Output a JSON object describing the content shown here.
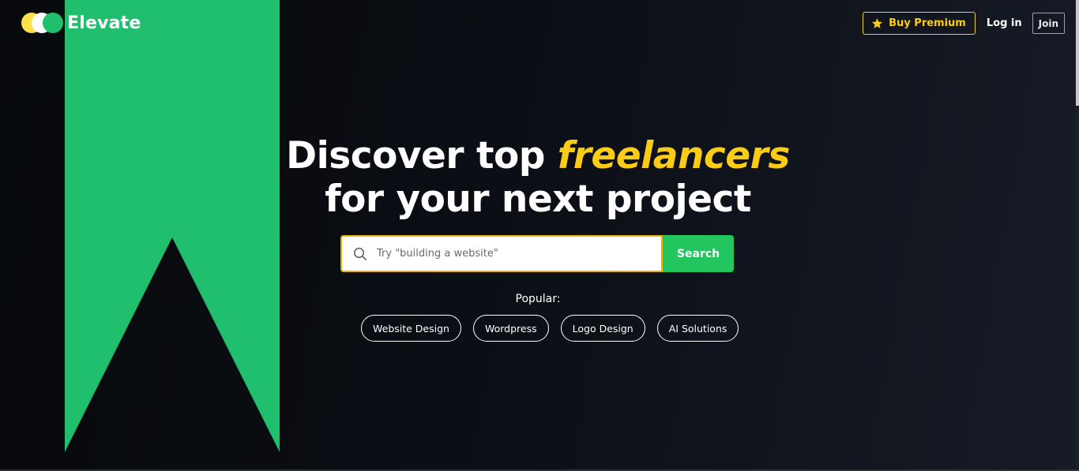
{
  "brand": {
    "name": "Elevate",
    "colors": {
      "green": "#1fbf6e",
      "yellow": "#facc15",
      "background": "#0b0e14"
    }
  },
  "nav": {
    "premium_label": "Buy Premium",
    "premium_icon": "star-icon",
    "login_label": "Log in",
    "join_label": "Join"
  },
  "hero": {
    "title_part1": "Discover top ",
    "title_accent": "freelancers",
    "title_part2": "for your next project"
  },
  "search": {
    "placeholder": "Try \"building a website\"",
    "value": "",
    "button_label": "Search",
    "icon": "search-icon"
  },
  "popular": {
    "label": "Popular:",
    "tags": [
      "Website Design",
      "Wordpress",
      "Logo Design",
      "AI Solutions"
    ]
  }
}
